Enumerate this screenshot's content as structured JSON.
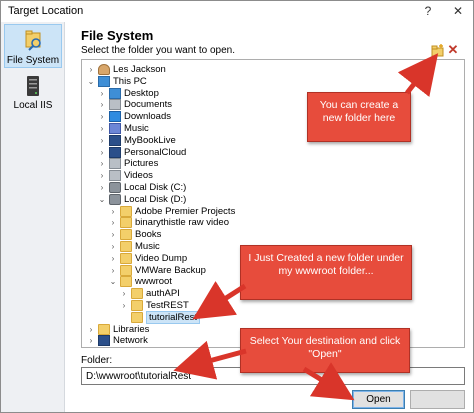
{
  "window": {
    "title": "Target Location",
    "help_glyph": "?",
    "close_glyph": "✕"
  },
  "sidebar": {
    "items": [
      {
        "label": "File System",
        "icon": "file-system-icon",
        "selected": true
      },
      {
        "label": "Local IIS",
        "icon": "server-icon",
        "selected": false
      }
    ]
  },
  "main": {
    "heading": "File System",
    "subheading": "Select the folder you want to open.",
    "new_folder_icon": "new-folder-icon",
    "delete_icon": "delete-icon",
    "delete_glyph": "✕"
  },
  "tree": [
    {
      "label": "Les Jackson",
      "icon": "person",
      "depth": 1,
      "expander": "›"
    },
    {
      "label": "This PC",
      "icon": "pc",
      "depth": 1,
      "expander": "⌄"
    },
    {
      "label": "Desktop",
      "icon": "blue",
      "depth": 2,
      "expander": "›"
    },
    {
      "label": "Documents",
      "icon": "grey",
      "depth": 2,
      "expander": "›"
    },
    {
      "label": "Downloads",
      "icon": "down",
      "depth": 2,
      "expander": "›"
    },
    {
      "label": "Music",
      "icon": "music",
      "depth": 2,
      "expander": "›"
    },
    {
      "label": "MyBookLive",
      "icon": "darkblue",
      "depth": 2,
      "expander": "›"
    },
    {
      "label": "PersonalCloud",
      "icon": "darkblue",
      "depth": 2,
      "expander": "›"
    },
    {
      "label": "Pictures",
      "icon": "grey",
      "depth": 2,
      "expander": "›"
    },
    {
      "label": "Videos",
      "icon": "grey",
      "depth": 2,
      "expander": "›"
    },
    {
      "label": "Local Disk (C:)",
      "icon": "drive",
      "depth": 2,
      "expander": "›"
    },
    {
      "label": "Local Disk (D:)",
      "icon": "drive",
      "depth": 2,
      "expander": "⌄"
    },
    {
      "label": "Adobe Premier Projects",
      "icon": "folder",
      "depth": 3,
      "expander": "›"
    },
    {
      "label": "binarythistle raw video",
      "icon": "folder",
      "depth": 3,
      "expander": "›"
    },
    {
      "label": "Books",
      "icon": "folder",
      "depth": 3,
      "expander": "›"
    },
    {
      "label": "Music",
      "icon": "folder",
      "depth": 3,
      "expander": "›"
    },
    {
      "label": "Video Dump",
      "icon": "folder",
      "depth": 3,
      "expander": "›"
    },
    {
      "label": "VMWare Backup",
      "icon": "folder",
      "depth": 3,
      "expander": "›"
    },
    {
      "label": "wwwroot",
      "icon": "folder",
      "depth": 3,
      "expander": "⌄"
    },
    {
      "label": "authAPI",
      "icon": "folder",
      "depth": 4,
      "expander": "›"
    },
    {
      "label": "TestREST",
      "icon": "folder",
      "depth": 4,
      "expander": "›"
    },
    {
      "label": "tutorialRest",
      "icon": "folder",
      "depth": 4,
      "expander": "",
      "selected": true
    },
    {
      "label": "Libraries",
      "icon": "folder",
      "depth": 1,
      "expander": "›"
    },
    {
      "label": "Network",
      "icon": "darkblue",
      "depth": 1,
      "expander": "›"
    }
  ],
  "folder": {
    "label": "Folder:",
    "value": "D:\\wwwroot\\tutorialRest"
  },
  "buttons": {
    "open": "Open"
  },
  "annotations": [
    "You can create a new folder here",
    "I Just Created a new folder under my wwwroot folder...",
    "Select Your destination and click \"Open\""
  ],
  "colors": {
    "accent_annotation": "#e74c3c",
    "selection": "#cce4f7",
    "folder": "#f3cf6a"
  }
}
